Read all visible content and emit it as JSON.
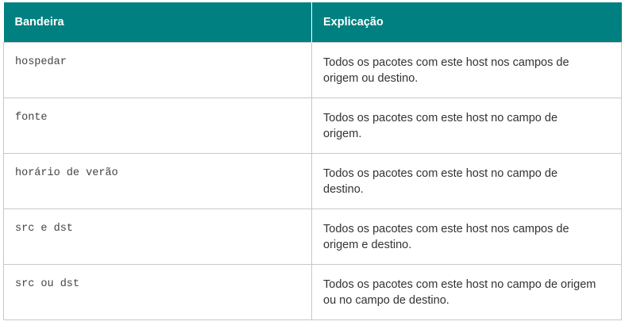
{
  "table": {
    "headers": [
      "Bandeira",
      "Explicação"
    ],
    "rows": [
      {
        "flag": "hospedar",
        "explanation": "Todos os pacotes com este host nos campos de origem ou destino."
      },
      {
        "flag": "fonte",
        "explanation": "Todos os pacotes com este host no campo de origem."
      },
      {
        "flag": "horário de verão",
        "explanation": "Todos os pacotes com este host no campo de destino."
      },
      {
        "flag": "src e dst",
        "explanation": "Todos os pacotes com este host nos campos de origem e destino."
      },
      {
        "flag": "src ou dst",
        "explanation": "Todos os pacotes com este host no campo de origem ou no campo de destino."
      }
    ]
  },
  "colors": {
    "header_bg": "#008080",
    "header_text": "#ffffff",
    "border": "#c8c8c8"
  }
}
